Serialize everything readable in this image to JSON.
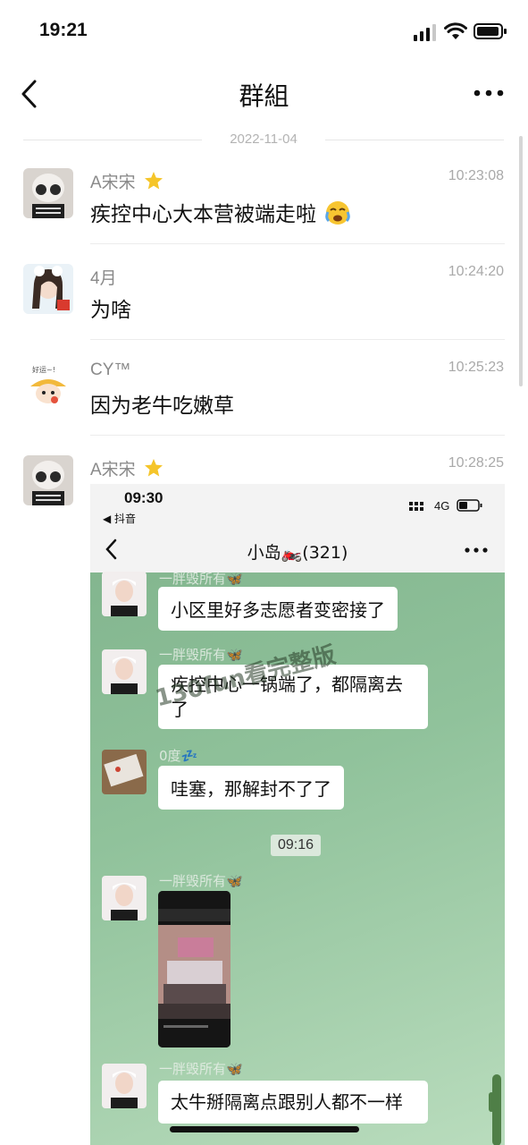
{
  "status_bar": {
    "time": "19:21"
  },
  "nav": {
    "title": "群組"
  },
  "date_divider": "2022-11-04",
  "messages": [
    {
      "sender": "A宋宋",
      "time": "10:23:08",
      "text": "疾控中心大本营被端走啦"
    },
    {
      "sender": "4月",
      "time": "10:24:20",
      "text": "为啥"
    },
    {
      "sender": "CY™",
      "time": "10:25:23",
      "text": "因为老牛吃嫩草"
    },
    {
      "sender": "A宋宋",
      "time": "10:28:25",
      "text": ""
    }
  ],
  "embedded": {
    "status_time": "09:30",
    "back_app": "◀ 抖音",
    "network": "4G",
    "title": "小岛🏍️(321)",
    "watermark": "130fun看完整版",
    "time_chip": "09:16",
    "chats": [
      {
        "name": "一胖毁所有🦋",
        "text": "小区里好多志愿者变密接了"
      },
      {
        "name": "一胖毁所有🦋",
        "text": "疾控中心一锅端了，都隔离去了"
      },
      {
        "name": "0度💤",
        "text": "哇塞，那解封不了了"
      },
      {
        "name": "一胖毁所有🦋",
        "text": ""
      },
      {
        "name": "一胖毁所有🦋",
        "text": "太牛掰隔离点跟别人都不一样"
      }
    ]
  },
  "colors": {
    "accent_bg": "#90c29b",
    "bubble": "#ffffff",
    "muted": "#8a8a8a"
  }
}
